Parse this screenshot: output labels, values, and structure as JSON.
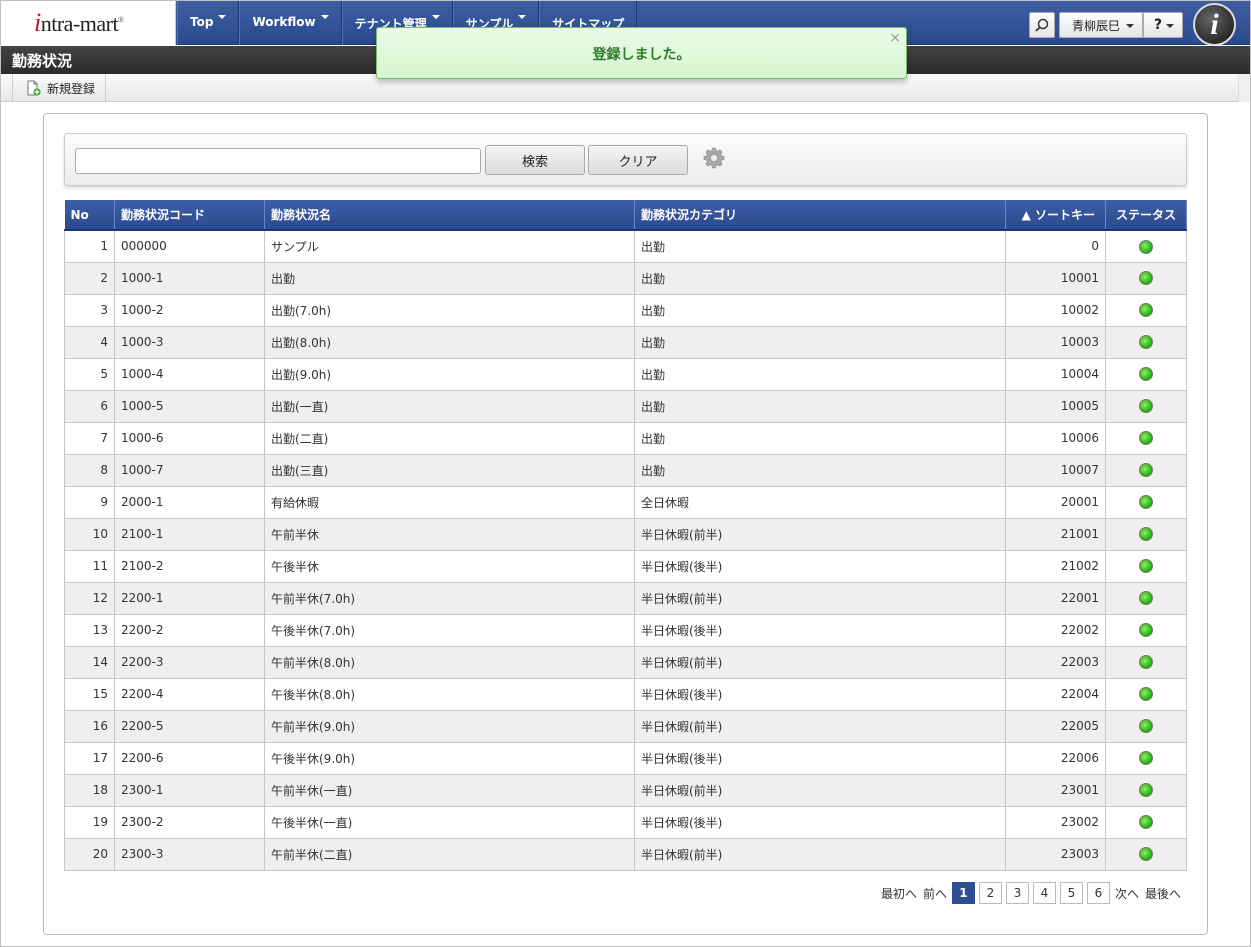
{
  "header": {
    "logo": "intra-mart",
    "nav": [
      {
        "label": "Top"
      },
      {
        "label": "Workflow"
      },
      {
        "label": "テナント管理"
      },
      {
        "label": "サンプル"
      },
      {
        "label": "サイトマップ"
      }
    ],
    "user": "青柳辰巳",
    "help": "?"
  },
  "page": {
    "title": "勤務状況",
    "new_button": "新規登録"
  },
  "toast": {
    "message": "登録しました。",
    "close": "×"
  },
  "search": {
    "value": "",
    "search_label": "検索",
    "clear_label": "クリア"
  },
  "table": {
    "headers": {
      "no": "No",
      "code": "勤務状況コード",
      "name": "勤務状況名",
      "category": "勤務状況カテゴリ",
      "sortkey": "▲ ソートキー",
      "status": "ステータス"
    },
    "rows": [
      {
        "no": "1",
        "code": "000000",
        "name": "サンプル",
        "category": "出勤",
        "sortkey": "0"
      },
      {
        "no": "2",
        "code": "1000-1",
        "name": "出勤",
        "category": "出勤",
        "sortkey": "10001"
      },
      {
        "no": "3",
        "code": "1000-2",
        "name": "出勤(7.0h)",
        "category": "出勤",
        "sortkey": "10002"
      },
      {
        "no": "4",
        "code": "1000-3",
        "name": "出勤(8.0h)",
        "category": "出勤",
        "sortkey": "10003"
      },
      {
        "no": "5",
        "code": "1000-4",
        "name": "出勤(9.0h)",
        "category": "出勤",
        "sortkey": "10004"
      },
      {
        "no": "6",
        "code": "1000-5",
        "name": "出勤(一直)",
        "category": "出勤",
        "sortkey": "10005"
      },
      {
        "no": "7",
        "code": "1000-6",
        "name": "出勤(二直)",
        "category": "出勤",
        "sortkey": "10006"
      },
      {
        "no": "8",
        "code": "1000-7",
        "name": "出勤(三直)",
        "category": "出勤",
        "sortkey": "10007"
      },
      {
        "no": "9",
        "code": "2000-1",
        "name": "有給休暇",
        "category": "全日休暇",
        "sortkey": "20001"
      },
      {
        "no": "10",
        "code": "2100-1",
        "name": "午前半休",
        "category": "半日休暇(前半)",
        "sortkey": "21001"
      },
      {
        "no": "11",
        "code": "2100-2",
        "name": "午後半休",
        "category": "半日休暇(後半)",
        "sortkey": "21002"
      },
      {
        "no": "12",
        "code": "2200-1",
        "name": "午前半休(7.0h)",
        "category": "半日休暇(前半)",
        "sortkey": "22001"
      },
      {
        "no": "13",
        "code": "2200-2",
        "name": "午後半休(7.0h)",
        "category": "半日休暇(後半)",
        "sortkey": "22002"
      },
      {
        "no": "14",
        "code": "2200-3",
        "name": "午前半休(8.0h)",
        "category": "半日休暇(前半)",
        "sortkey": "22003"
      },
      {
        "no": "15",
        "code": "2200-4",
        "name": "午後半休(8.0h)",
        "category": "半日休暇(後半)",
        "sortkey": "22004"
      },
      {
        "no": "16",
        "code": "2200-5",
        "name": "午前半休(9.0h)",
        "category": "半日休暇(前半)",
        "sortkey": "22005"
      },
      {
        "no": "17",
        "code": "2200-6",
        "name": "午後半休(9.0h)",
        "category": "半日休暇(後半)",
        "sortkey": "22006"
      },
      {
        "no": "18",
        "code": "2300-1",
        "name": "午前半休(一直)",
        "category": "半日休暇(前半)",
        "sortkey": "23001"
      },
      {
        "no": "19",
        "code": "2300-2",
        "name": "午後半休(一直)",
        "category": "半日休暇(後半)",
        "sortkey": "23002"
      },
      {
        "no": "20",
        "code": "2300-3",
        "name": "午前半休(二直)",
        "category": "半日休暇(前半)",
        "sortkey": "23003"
      }
    ]
  },
  "pager": {
    "first": "最初へ",
    "prev": "前へ",
    "pages": [
      "1",
      "2",
      "3",
      "4",
      "5",
      "6"
    ],
    "current": "1",
    "next": "次へ",
    "last": "最後へ"
  },
  "icons": {
    "search": "search-icon",
    "new": "new-document-icon",
    "gear": "gear-icon",
    "status": "status-active-icon"
  },
  "colors": {
    "header": "#2f4f95",
    "toast_bg": "#dff7d9",
    "toast_text": "#2f7a2a",
    "status_active": "#2bb51e"
  }
}
